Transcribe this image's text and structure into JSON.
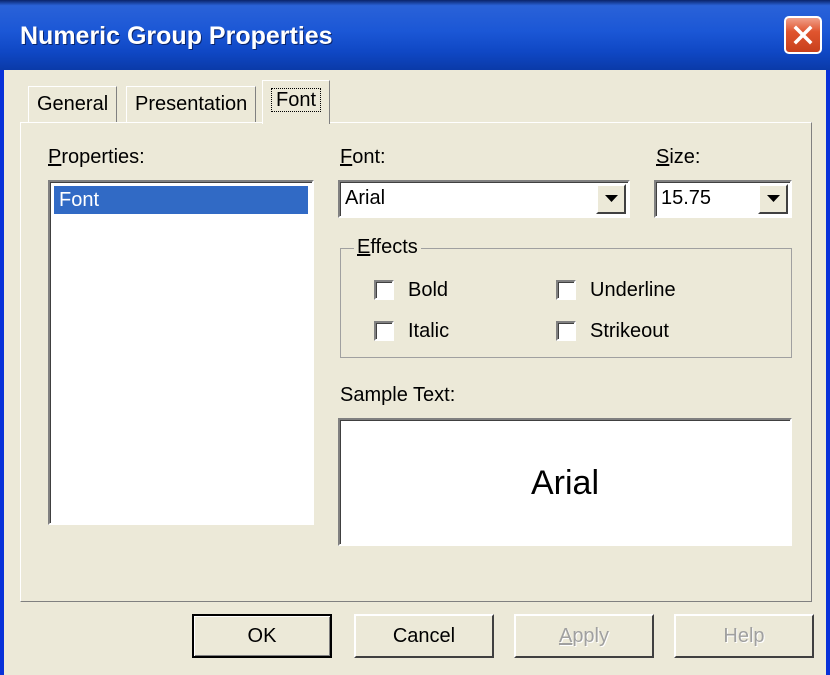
{
  "window": {
    "title": "Numeric Group Properties"
  },
  "tabs": [
    {
      "label": "General"
    },
    {
      "label": "Presentation"
    },
    {
      "label": "Font",
      "active": true
    }
  ],
  "properties": {
    "label": "Properties:",
    "items": [
      {
        "label": "Font",
        "selected": true
      }
    ]
  },
  "font": {
    "label": "Font:",
    "value": "Arial"
  },
  "size": {
    "label": "Size:",
    "value": "15.75"
  },
  "effects": {
    "title": "Effects",
    "options": [
      {
        "label": "Bold",
        "checked": false
      },
      {
        "label": "Underline",
        "checked": false
      },
      {
        "label": "Italic",
        "checked": false
      },
      {
        "label": "Strikeout",
        "checked": false
      }
    ]
  },
  "sample": {
    "label": "Sample Text:",
    "text": "Arial"
  },
  "buttons": {
    "ok": "OK",
    "cancel": "Cancel",
    "apply": "Apply",
    "help": "Help"
  },
  "colors": {
    "titlebar": "#0a3aa8",
    "selection": "#316ac5",
    "close": "#e0552f",
    "face": "#ece9d8"
  },
  "icons": {
    "close": "close-icon",
    "dropdown": "chevron-down-icon"
  }
}
